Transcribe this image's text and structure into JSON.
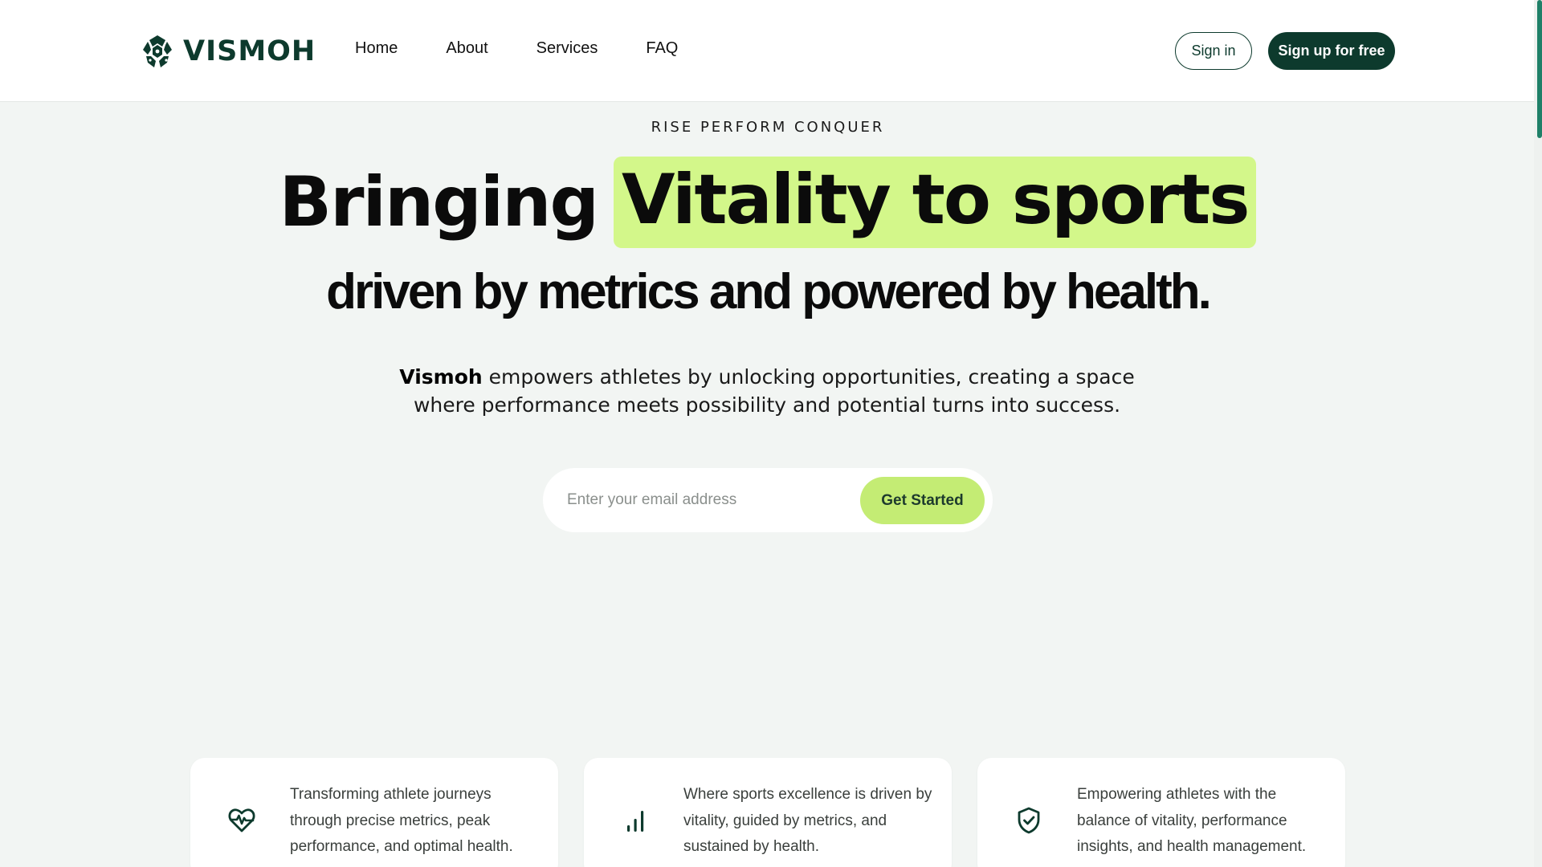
{
  "brand": {
    "name": "VISMOH",
    "logo_icon": "vismoh-logo-icon",
    "color": "#0d3a2d"
  },
  "nav": {
    "items": [
      {
        "label": "Home"
      },
      {
        "label": "About"
      },
      {
        "label": "Services"
      },
      {
        "label": "FAQ"
      }
    ]
  },
  "auth": {
    "signin_label": "Sign in",
    "signup_label": "Sign up for free"
  },
  "hero": {
    "eyebrow": "RISE PERFORM CONQUER",
    "headline_plain": "Bringing",
    "headline_highlight": "Vitality to sports",
    "highlight_color": "#d3f78a",
    "subhead": "driven by metrics and powered by health.",
    "description_brand": "Vismoh",
    "description_rest": " empowers athletes by unlocking opportunities, creating a space where performance meets possibility and potential turns into success."
  },
  "signup_form": {
    "email_placeholder": "Enter your email address",
    "email_value": "",
    "button_label": "Get Started",
    "button_color": "#c4ec74"
  },
  "features": [
    {
      "icon": "heart-pulse-icon",
      "text": "Transforming athlete journeys through precise metrics, peak performance, and optimal health."
    },
    {
      "icon": "bar-chart-icon",
      "text": "Where sports excellence is driven by vitality, guided by metrics, and sustained by health."
    },
    {
      "icon": "shield-check-icon",
      "text": "Empowering athletes with the balance of vitality, performance insights, and health management."
    }
  ]
}
